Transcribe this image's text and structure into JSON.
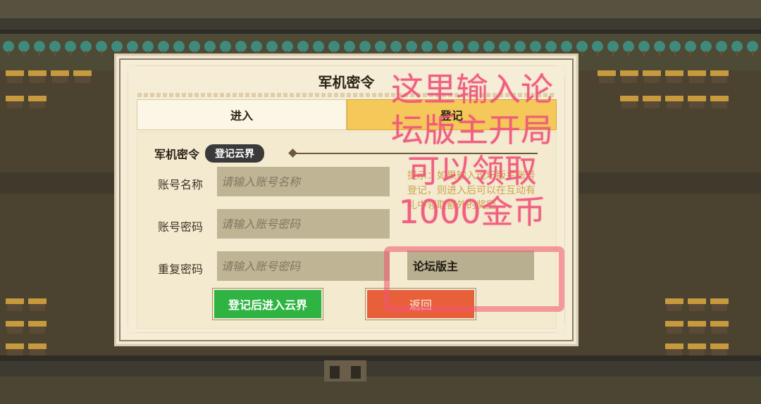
{
  "dialog": {
    "title": "军机密令",
    "tabs": [
      {
        "label": "进入",
        "active": false
      },
      {
        "label": "登记",
        "active": true
      }
    ],
    "section": {
      "label": "军机密令",
      "pill": "登记云界"
    },
    "fields": [
      {
        "label": "账号名称",
        "placeholder": "请输入账号名称"
      },
      {
        "label": "账号密码",
        "placeholder": "请输入账号密码"
      },
      {
        "label": "重复密码",
        "placeholder": "请输入账号密码"
      }
    ],
    "hint": "提示：如果输入论坛版主账号登记，则进入后可以在互动有礼中领取额外的奖励",
    "forum_value": "论坛版主",
    "buttons": {
      "submit": "登记后进入云界",
      "back": "返回"
    }
  },
  "annotation": {
    "lines": [
      "这里输入论",
      "坛版主开局",
      "可以领取",
      "1000金币"
    ]
  },
  "colors": {
    "accent_tab": "#f5c85a",
    "primary_button": "#2fb443",
    "back_button": "#e8603a",
    "annotation": "#f0547a"
  }
}
